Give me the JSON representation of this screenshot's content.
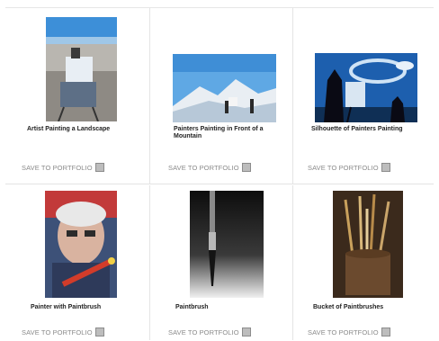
{
  "items": [
    {
      "caption": "Artist Painting a Landscape",
      "save_label": "SAVE TO PORTFOLIO"
    },
    {
      "caption": "Painters Painting in Front of a Mountain",
      "save_label": "SAVE TO PORTFOLIO"
    },
    {
      "caption": "Silhouette of Painters Painting",
      "save_label": "SAVE TO PORTFOLIO"
    },
    {
      "caption": "Painter with Paintbrush",
      "save_label": "SAVE TO PORTFOLIO"
    },
    {
      "caption": "Paintbrush",
      "save_label": "SAVE TO PORTFOLIO"
    },
    {
      "caption": "Bucket of Paintbrushes",
      "save_label": "SAVE TO PORTFOLIO"
    }
  ]
}
